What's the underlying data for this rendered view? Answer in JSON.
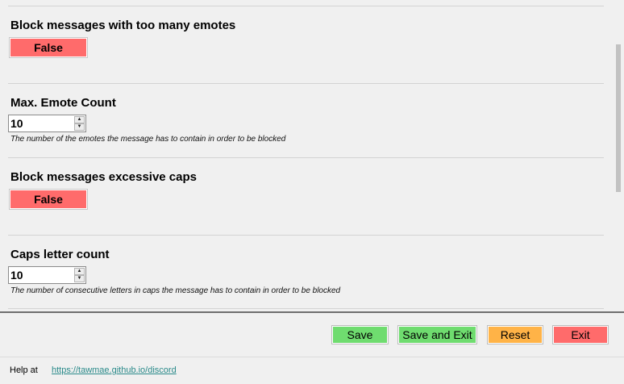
{
  "settings": [
    {
      "title": "Block messages with too many emotes",
      "type": "toggle",
      "value": "False"
    },
    {
      "title": "Max. Emote Count",
      "type": "number",
      "value": "10",
      "description": "The number of the emotes the message has to contain in order to be blocked"
    },
    {
      "title": "Block messages excessive caps",
      "type": "toggle",
      "value": "False"
    },
    {
      "title": "Caps letter count",
      "type": "number",
      "value": "10",
      "description": "The number of consecutive letters in caps the message has to contain in order to be blocked"
    }
  ],
  "spin_glyphs": {
    "up": "▲",
    "down": "▼"
  },
  "buttons": {
    "save": "Save",
    "save_and_exit": "Save and Exit",
    "reset": "Reset",
    "exit": "Exit"
  },
  "footer": {
    "help_label": "Help at",
    "help_link": "https://tawmae.github.io/discord"
  },
  "colors": {
    "toggle_false": "#ff6b6b",
    "save": "#6fdc6f",
    "reset": "#ffb347",
    "exit": "#ff6b6b",
    "link": "#2a8a8a"
  }
}
